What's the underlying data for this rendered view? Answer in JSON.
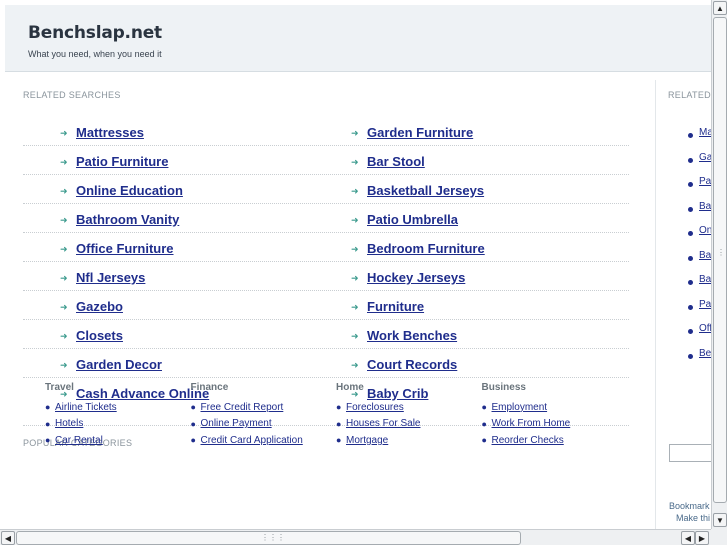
{
  "header": {
    "title": "Benchslap.net",
    "tagline": "What you need, when you need it"
  },
  "related": {
    "label": "RELATED SEARCHES",
    "rows": [
      [
        "Mattresses",
        "Garden Furniture"
      ],
      [
        "Patio Furniture",
        "Bar Stool"
      ],
      [
        "Online Education",
        "Basketball Jerseys"
      ],
      [
        "Bathroom Vanity",
        "Patio Umbrella"
      ],
      [
        "Office Furniture",
        "Bedroom Furniture"
      ],
      [
        "Nfl Jerseys",
        "Hockey Jerseys"
      ],
      [
        "Gazebo",
        "Furniture"
      ],
      [
        "Closets",
        "Work Benches"
      ],
      [
        "Garden Decor",
        "Court Records"
      ],
      [
        "Cash Advance Online",
        "Baby Crib"
      ]
    ]
  },
  "popular": {
    "label": "POPULAR CATEGORIES",
    "columns": [
      {
        "title": "Travel",
        "items": [
          "Airline Tickets",
          "Hotels",
          "Car Rental"
        ]
      },
      {
        "title": "Finance",
        "items": [
          "Free Credit Report",
          "Online Payment",
          "Credit Card Application"
        ]
      },
      {
        "title": "Home",
        "items": [
          "Foreclosures",
          "Houses For Sale",
          "Mortgage"
        ]
      },
      {
        "title": "Business",
        "items": [
          "Employment",
          "Work From Home",
          "Reorder Checks"
        ]
      }
    ]
  },
  "sidebar": {
    "label": "RELATED",
    "items": [
      "Ma",
      "Ga",
      "Pat",
      "Ba",
      "On",
      "Ba",
      "Ba",
      "Pa",
      "Off",
      "Be"
    ],
    "bookmark_line1": "Bookmark",
    "bookmark_line2": "Make thi"
  },
  "scrollbars": {
    "up": "▲",
    "down": "▼",
    "left": "◀",
    "right": "▶",
    "grip": "⋮⋮⋮"
  }
}
